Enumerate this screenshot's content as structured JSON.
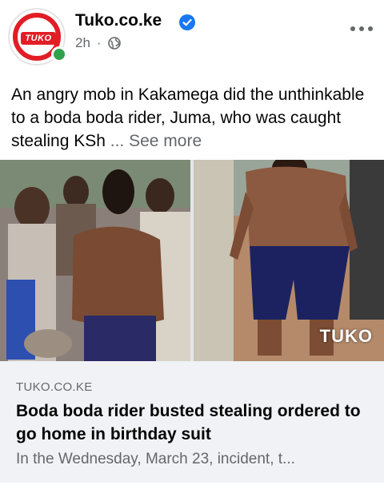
{
  "header": {
    "avatar_text": "TUKO",
    "page_name": "Tuko.co.ke",
    "time": "2h",
    "dot": "·",
    "privacy_icon": "globe-icon",
    "verified_icon": "verified-badge-icon",
    "more_icon": "more-options-icon"
  },
  "post": {
    "text": "An angry mob in Kakamega did the unthinkable to a boda boda rider, Juma, who was caught stealing KSh",
    "see_more": "... See more"
  },
  "media": {
    "watermark": "TUKO"
  },
  "link": {
    "domain": "TUKO.CO.KE",
    "title": "Boda boda rider busted stealing ordered to go home in birthday suit",
    "description": "In the Wednesday, March 23, incident, t..."
  },
  "colors": {
    "brand_red": "#e21d25",
    "verified_blue": "#1877f2",
    "online_green": "#31a24c",
    "secondary_text": "#65676b",
    "card_bg": "#f0f2f5"
  }
}
